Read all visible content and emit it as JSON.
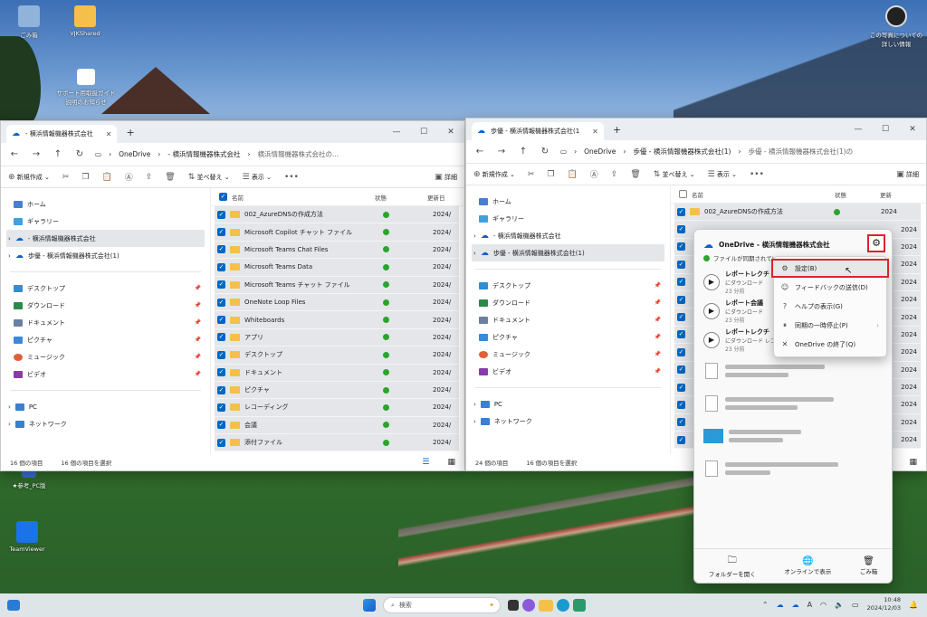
{
  "desktop": {
    "icons": [
      {
        "label": "ごみ箱",
        "color": "#8fb3d9"
      },
      {
        "label": "VJKShared",
        "color": "#f5c04a"
      },
      {
        "label": "サポート用取扱ガイド説明のお知らせ",
        "color": "#ffffff"
      },
      {
        "label": "★参考_PC版",
        "color": "#3a6fd0"
      },
      {
        "label": "TeamViewer",
        "color": "#1a73e8"
      }
    ],
    "corner_text": "この写真についての詳しい情報"
  },
  "left_window": {
    "tab_title": "- 横浜情報機器株式会社",
    "breadcrumb": [
      "OneDrive",
      "- 横浜情報機器株式会社",
      "横浜情報機器株式会社の..."
    ],
    "toolbar": {
      "new": "新規作成",
      "sort": "並べ替え",
      "view": "表示",
      "details": "詳細"
    },
    "sidebar": [
      {
        "label": "ホーム",
        "color": "#4a7fd0",
        "pinned": false,
        "selected": false
      },
      {
        "label": "ギャラリー",
        "color": "#3fa0e0",
        "pinned": false,
        "selected": false
      },
      {
        "label": "- 横浜情報機器株式会社",
        "color": "#0a64c8",
        "pinned": false,
        "selected": true
      },
      {
        "label": "歩優 - 横浜情報機器株式会社(1)",
        "color": "#0a64c8",
        "pinned": false,
        "selected": false
      },
      {
        "label": "デスクトップ",
        "color": "#2d8fd8",
        "pinned": true,
        "selected": false
      },
      {
        "label": "ダウンロード",
        "color": "#2a8a4a",
        "pinned": true,
        "selected": false
      },
      {
        "label": "ドキュメント",
        "color": "#6b7fa0",
        "pinned": true,
        "selected": false
      },
      {
        "label": "ピクチャ",
        "color": "#3a8ad8",
        "pinned": true,
        "selected": false
      },
      {
        "label": "ミュージック",
        "color": "#e0603a",
        "pinned": true,
        "selected": false
      },
      {
        "label": "ビデオ",
        "color": "#8a3ab0",
        "pinned": true,
        "selected": false
      },
      {
        "label": "PC",
        "color": "#3a7fd0",
        "pinned": false,
        "selected": false
      },
      {
        "label": "ネットワーク",
        "color": "#3a7fd0",
        "pinned": false,
        "selected": false
      }
    ],
    "columns": {
      "name": "名前",
      "status": "状態",
      "date": "更新日"
    },
    "files": [
      {
        "name": "002_AzureDNSの作成方法",
        "date": "2024/"
      },
      {
        "name": "Microsoft Copilot チャット ファイル",
        "date": "2024/"
      },
      {
        "name": "Microsoft Teams Chat Files",
        "date": "2024/"
      },
      {
        "name": "Microsoft Teams Data",
        "date": "2024/"
      },
      {
        "name": "Microsoft Teams チャット ファイル",
        "date": "2024/"
      },
      {
        "name": "OneNote Loop Files",
        "date": "2024/"
      },
      {
        "name": "Whiteboards",
        "date": "2024/"
      },
      {
        "name": "アプリ",
        "date": "2024/"
      },
      {
        "name": "デスクトップ",
        "date": "2024/"
      },
      {
        "name": "ドキュメント",
        "date": "2024/"
      },
      {
        "name": "ピクチャ",
        "date": "2024/"
      },
      {
        "name": "レコーディング",
        "date": "2024/"
      },
      {
        "name": "会議",
        "date": "2024/"
      },
      {
        "name": "添付ファイル",
        "date": "2024/"
      }
    ],
    "status_bar": {
      "count": "16 個の項目",
      "selected": "16 個の項目を選択"
    }
  },
  "right_window": {
    "tab_title": "歩優 - 横浜情報機器株式会社(1",
    "breadcrumb": [
      "OneDrive",
      "歩優 - 横浜情報機器株式会社(1)",
      "歩優 - 横浜情報機器株式会社(1)の"
    ],
    "toolbar": {
      "new": "新規作成",
      "sort": "並べ替え",
      "view": "表示",
      "details": "詳細"
    },
    "sidebar": [
      {
        "label": "ホーム",
        "color": "#4a7fd0",
        "pinned": false,
        "selected": false
      },
      {
        "label": "ギャラリー",
        "color": "#3fa0e0",
        "pinned": false,
        "selected": false
      },
      {
        "label": "- 横浜情報機器株式会社",
        "color": "#0a64c8",
        "pinned": false,
        "selected": false
      },
      {
        "label": "歩優 - 横浜情報機器株式会社(1)",
        "color": "#0a64c8",
        "pinned": false,
        "selected": true
      },
      {
        "label": "デスクトップ",
        "color": "#2d8fd8",
        "pinned": true,
        "selected": false
      },
      {
        "label": "ダウンロード",
        "color": "#2a8a4a",
        "pinned": true,
        "selected": false
      },
      {
        "label": "ドキュメント",
        "color": "#6b7fa0",
        "pinned": true,
        "selected": false
      },
      {
        "label": "ピクチャ",
        "color": "#3a8ad8",
        "pinned": true,
        "selected": false
      },
      {
        "label": "ミュージック",
        "color": "#e0603a",
        "pinned": true,
        "selected": false
      },
      {
        "label": "ビデオ",
        "color": "#8a3ab0",
        "pinned": true,
        "selected": false
      },
      {
        "label": "PC",
        "color": "#3a7fd0",
        "pinned": false,
        "selected": false
      },
      {
        "label": "ネットワーク",
        "color": "#3a7fd0",
        "pinned": false,
        "selected": false
      }
    ],
    "columns": {
      "name": "名前",
      "status": "状態",
      "date": "更新"
    },
    "first_file": {
      "name": "002_AzureDNSの作成方法",
      "date": "2024"
    },
    "other_dates": [
      "2024",
      "2024",
      "2024",
      "2024",
      "2024",
      "2024",
      "2024",
      "2024",
      "2024",
      "2024",
      "2024",
      "2024",
      "2024"
    ],
    "status_bar": {
      "count": "24 個の項目",
      "selected": "16 個の項目を選択"
    }
  },
  "onedrive_flyout": {
    "title": "OneDrive - 横浜情報機器株式会社",
    "sync_status": "ファイルが同期されています",
    "activities": [
      {
        "title": "レポートレクチ",
        "sub": "にダウンロード",
        "time": "23 分前"
      },
      {
        "title": "レポート会議",
        "sub": "にダウンロード",
        "time": "23 分前"
      },
      {
        "title": "レポートレクチ",
        "sub": "にダウンロード レコーディング",
        "time": "23 分前"
      }
    ],
    "footer": [
      {
        "label": "フォルダーを開く",
        "icon": "folder-icon"
      },
      {
        "label": "オンラインで表示",
        "icon": "globe-icon"
      },
      {
        "label": "ごみ箱",
        "icon": "trash-icon"
      }
    ]
  },
  "context_menu": {
    "items": [
      {
        "label": "設定(B)",
        "icon": "gear-icon",
        "highlight": true
      },
      {
        "label": "フィードバックの送信(D)",
        "icon": "feedback-icon",
        "highlight": false
      },
      {
        "label": "ヘルプの表示(G)",
        "icon": "help-icon",
        "highlight": false
      },
      {
        "label": "同期の一時停止(P)",
        "icon": "pause-icon",
        "highlight": false
      },
      {
        "label": "OneDrive の終了(Q)",
        "icon": "close-icon",
        "highlight": false
      }
    ]
  },
  "taskbar": {
    "search_placeholder": "検索",
    "time": "10:48",
    "date": "2024/12/03",
    "apps": [
      {
        "name": "widgets",
        "color": "#2a7ad8"
      },
      {
        "name": "start",
        "color": "#2a7ad8"
      },
      {
        "name": "task-view",
        "color": "#333333"
      },
      {
        "name": "copilot",
        "color": "#8a5ad8"
      },
      {
        "name": "explorer",
        "color": "#f5c04a"
      },
      {
        "name": "edge",
        "color": "#1a9ad0"
      },
      {
        "name": "store",
        "color": "#2a9a6a"
      }
    ]
  }
}
